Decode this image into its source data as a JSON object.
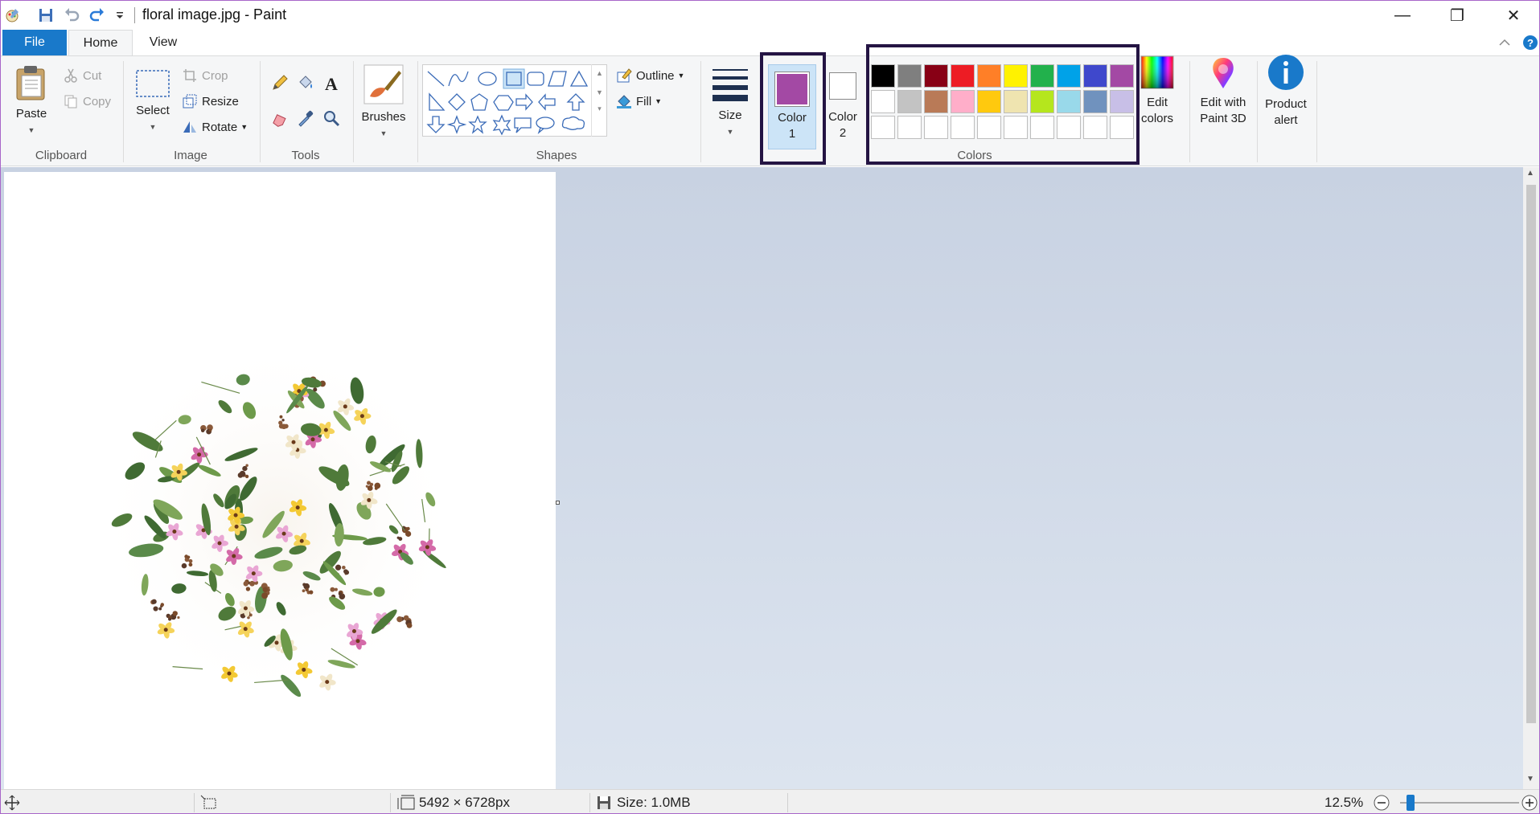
{
  "window": {
    "title": "floral image.jpg - Paint",
    "minimize": "—",
    "restore": "❐",
    "close": "✕"
  },
  "tabs": {
    "file": "File",
    "home": "Home",
    "view": "View"
  },
  "clipboard": {
    "paste": "Paste",
    "cut": "Cut",
    "copy": "Copy",
    "group": "Clipboard"
  },
  "image": {
    "select": "Select",
    "crop": "Crop",
    "resize": "Resize",
    "rotate": "Rotate",
    "group": "Image"
  },
  "tools": {
    "group": "Tools"
  },
  "brushes": {
    "label": "Brushes"
  },
  "shapes": {
    "outline": "Outline",
    "fill": "Fill",
    "group": "Shapes",
    "items": [
      "line",
      "curve",
      "oval",
      "rectangle",
      "rounded-rectangle",
      "polygon",
      "triangle",
      "right-triangle",
      "diamond",
      "pentagon",
      "hexagon",
      "right-arrow",
      "left-arrow",
      "up-arrow",
      "down-arrow",
      "four-point-star",
      "five-point-star",
      "six-point-star",
      "rounded-callout",
      "oval-callout",
      "cloud-callout"
    ]
  },
  "size": {
    "label": "Size"
  },
  "colors": {
    "color1_label_line1": "Color",
    "color1_label_line2": "1",
    "color2_label_line1": "Color",
    "color2_label_line2": "2",
    "color1_value": "#a349a4",
    "color2_value": "#ffffff",
    "group": "Colors",
    "edit_line1": "Edit",
    "edit_line2": "colors",
    "palette_row1": [
      "#000000",
      "#7f7f7f",
      "#880015",
      "#ed1c24",
      "#ff7f27",
      "#fff200",
      "#22b14c",
      "#00a2e8",
      "#3f48cc",
      "#a349a4"
    ],
    "palette_row2": [
      "#ffffff",
      "#c3c3c3",
      "#b97a57",
      "#ffaec9",
      "#ffc90e",
      "#efe4b0",
      "#b5e61d",
      "#99d9ea",
      "#7092be",
      "#c8bfe7"
    ],
    "palette_row3": [
      "#ffffff",
      "#ffffff",
      "#ffffff",
      "#ffffff",
      "#ffffff",
      "#ffffff",
      "#ffffff",
      "#ffffff",
      "#ffffff",
      "#ffffff"
    ],
    "highlight_color": "#241443"
  },
  "paint3d": {
    "line1": "Edit with",
    "line2": "Paint 3D"
  },
  "product_alert": {
    "line1": "Product",
    "line2": "alert"
  },
  "status": {
    "dimensions": "5492 × 6728px",
    "size": "Size: 1.0MB",
    "zoom": "12.5%",
    "zoom_fraction": 0.125
  },
  "canvas": {
    "content": "floral-wreath-image"
  }
}
